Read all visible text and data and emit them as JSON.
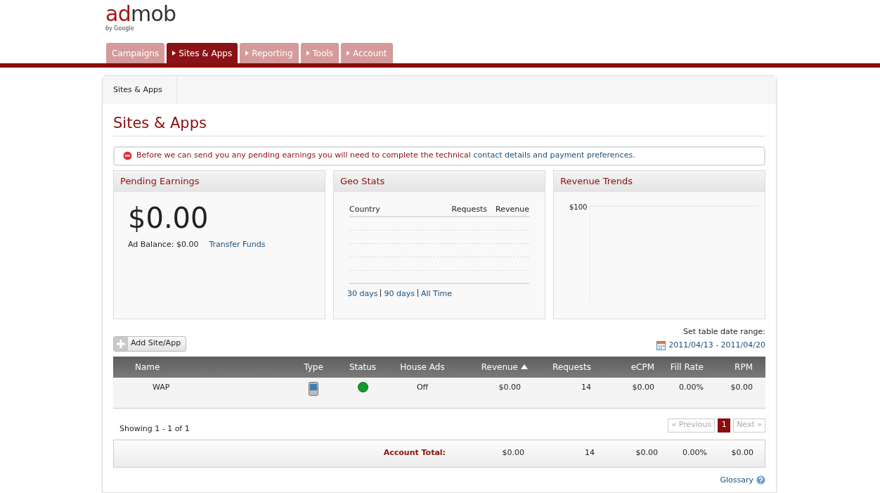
{
  "logo": {
    "name": "admob",
    "tagline": "by Google"
  },
  "tabs": [
    {
      "label": "Campaigns",
      "selected": false,
      "caret": false
    },
    {
      "label": "Sites & Apps",
      "selected": true,
      "caret": true
    },
    {
      "label": "Reporting",
      "selected": false,
      "caret": true
    },
    {
      "label": "Tools",
      "selected": false,
      "caret": true
    },
    {
      "label": "Account",
      "selected": false,
      "caret": true
    }
  ],
  "breadcrumb": [
    "Sites & Apps"
  ],
  "page_title": "Sites & Apps",
  "alert": {
    "text": "Before we can send you any pending earnings you will need to complete the technical",
    "link": "contact details and payment preferences",
    "end": "."
  },
  "pending": {
    "title": "Pending Earnings",
    "amount": "$0.00",
    "balance": "Ad Balance: $0.00",
    "link": "Transfer Funds"
  },
  "geo": {
    "title": "Geo Stats",
    "columns": [
      "Country",
      "Requests",
      "Revenue"
    ],
    "periods": [
      "30 days",
      "90 days",
      "All Time"
    ]
  },
  "trends": {
    "title": "Revenue Trends",
    "ytick": "$100"
  },
  "add_button": "Add Site/App",
  "date_range": {
    "label": "Set table date range:",
    "value": "2011/04/13 - 2011/04/20"
  },
  "table": {
    "columns": [
      {
        "label": "Name",
        "sorted": false
      },
      {
        "label": "Type",
        "sorted": false
      },
      {
        "label": "Status",
        "sorted": false
      },
      {
        "label": "House Ads",
        "sorted": false
      },
      {
        "label": "Revenue",
        "sorted": true
      },
      {
        "label": "Requests",
        "sorted": false
      },
      {
        "label": "eCPM",
        "sorted": false
      },
      {
        "label": "Fill Rate",
        "sorted": false
      },
      {
        "label": "RPM",
        "sorted": false
      }
    ],
    "rows": [
      {
        "name": "WAP",
        "active": true,
        "house_ads": "Off",
        "revenue": "$0.00",
        "requests": "14",
        "ecpm": "$0.00",
        "fill_rate": "0.00%",
        "rpm": "$0.00"
      }
    ]
  },
  "showing": "Showing 1 - 1 of 1",
  "pagination": {
    "previous": {
      "label": "« Previous",
      "disabled": true
    },
    "pages": [
      {
        "label": "1",
        "selected": true
      }
    ],
    "next": {
      "label": "Next »",
      "disabled": true
    }
  },
  "total": {
    "label": "Account Total:",
    "revenue": "$0.00",
    "requests": "14",
    "ecpm": "$0.00",
    "fill_rate": "0.00%",
    "rpm": "$0.00"
  },
  "glossary": "Glossary"
}
